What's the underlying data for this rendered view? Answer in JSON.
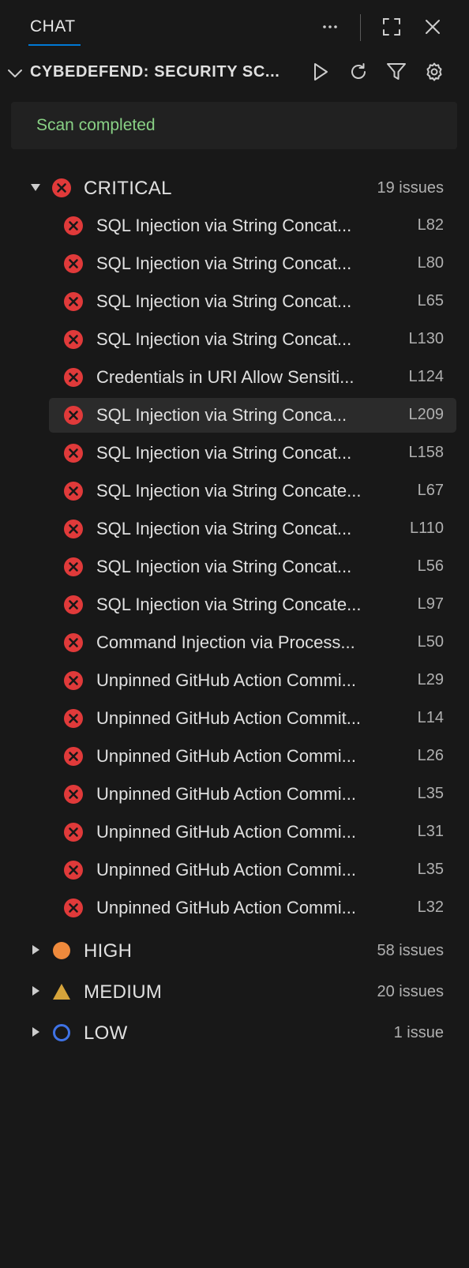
{
  "tabs": {
    "chat_label": "CHAT"
  },
  "section": {
    "title": "CYBEDEFEND: SECURITY SC..."
  },
  "status": {
    "text": "Scan completed"
  },
  "colors": {
    "critical": "#e03a3a",
    "high": "#ef8a3c",
    "medium": "#d6a43b",
    "low": "#3f73e6",
    "accent": "#0078d4",
    "success": "#89d185"
  },
  "icons": {
    "more": "more-icon",
    "maximize": "maximize-icon",
    "close": "close-icon",
    "run": "play-icon",
    "refresh": "refresh-icon",
    "filter": "filter-icon",
    "settings": "gear-icon"
  },
  "groups": [
    {
      "label": "CRITICAL",
      "count": "19 issues",
      "expanded": true,
      "issues": [
        {
          "label": "SQL Injection via String Concat...",
          "line": "L82"
        },
        {
          "label": "SQL Injection via String Concat...",
          "line": "L80"
        },
        {
          "label": "SQL Injection via String Concat...",
          "line": "L65"
        },
        {
          "label": "SQL Injection via String Concat...",
          "line": "L130"
        },
        {
          "label": "Credentials in URI Allow Sensiti...",
          "line": "L124"
        },
        {
          "label": "SQL Injection via String Conca...",
          "line": "L209",
          "selected": true
        },
        {
          "label": "SQL Injection via String Concat...",
          "line": "L158"
        },
        {
          "label": "SQL Injection via String Concate...",
          "line": "L67"
        },
        {
          "label": "SQL Injection via String Concat...",
          "line": "L110"
        },
        {
          "label": "SQL Injection via String Concat...",
          "line": "L56"
        },
        {
          "label": "SQL Injection via String Concate...",
          "line": "L97"
        },
        {
          "label": "Command Injection via Process...",
          "line": "L50"
        },
        {
          "label": "Unpinned GitHub Action Commi...",
          "line": "L29"
        },
        {
          "label": "Unpinned GitHub Action Commit...",
          "line": "L14"
        },
        {
          "label": "Unpinned GitHub Action Commi...",
          "line": "L26"
        },
        {
          "label": "Unpinned GitHub Action Commi...",
          "line": "L35"
        },
        {
          "label": "Unpinned GitHub Action Commi...",
          "line": "L31"
        },
        {
          "label": "Unpinned GitHub Action Commi...",
          "line": "L35"
        },
        {
          "label": "Unpinned GitHub Action Commi...",
          "line": "L32"
        }
      ]
    },
    {
      "label": "HIGH",
      "count": "58 issues",
      "expanded": false
    },
    {
      "label": "MEDIUM",
      "count": "20 issues",
      "expanded": false
    },
    {
      "label": "LOW",
      "count": "1 issue",
      "expanded": false
    }
  ]
}
